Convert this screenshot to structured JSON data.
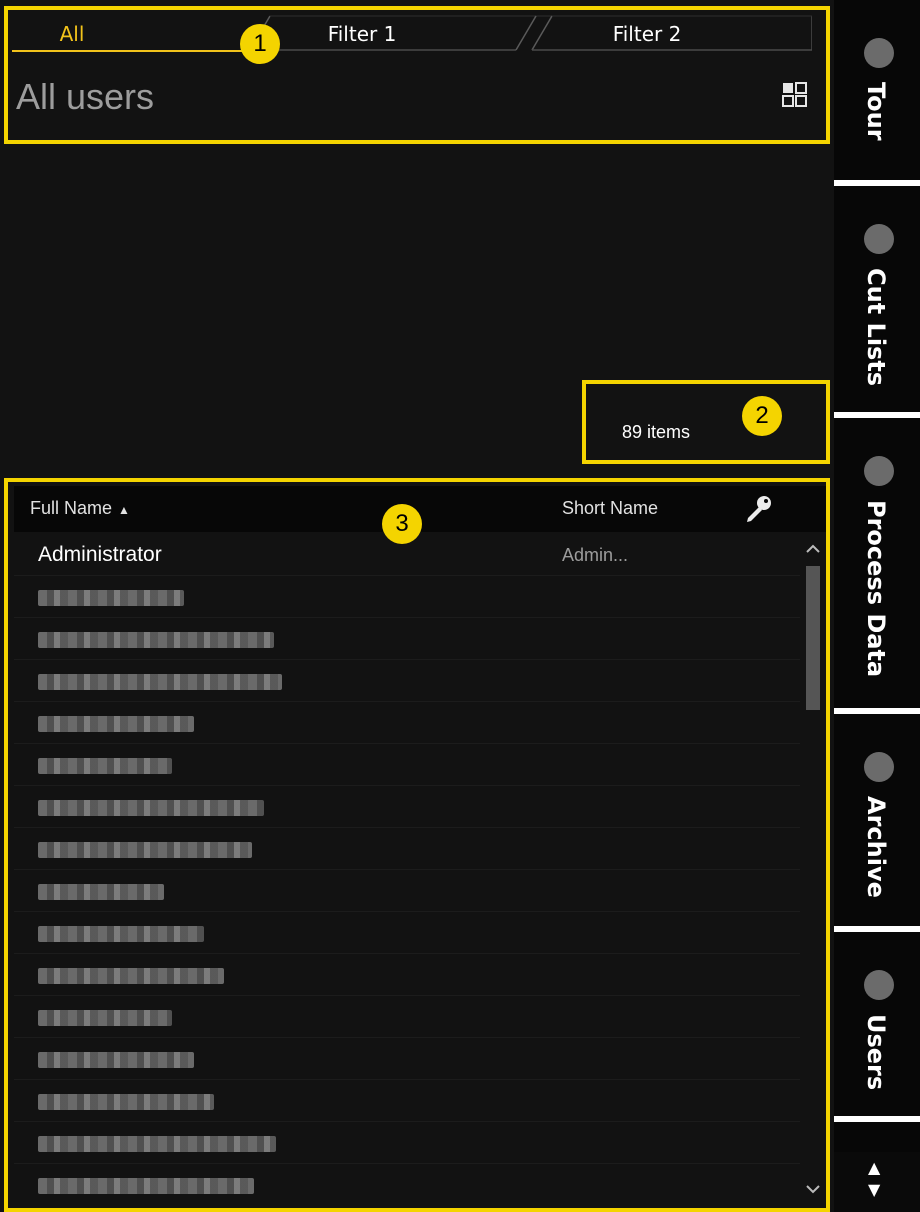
{
  "tabs": [
    {
      "label": "All",
      "active": true
    },
    {
      "label": "Filter 1",
      "active": false
    },
    {
      "label": "Filter 2",
      "active": false
    }
  ],
  "page_title": "All users",
  "view_toggle_icon": "grid-view-icon",
  "items_count": "89 items",
  "table": {
    "columns": {
      "full_name": "Full Name",
      "short_name": "Short Name",
      "key": "key-icon"
    },
    "sort_indicator": "▲",
    "rows": [
      {
        "full_name": "Administrator",
        "short_name": "Admin..."
      }
    ],
    "redacted_rows": 15
  },
  "sidebar": {
    "items": [
      {
        "label": "Tour"
      },
      {
        "label": "Cut Lists"
      },
      {
        "label": "Process Data"
      },
      {
        "label": "Archive"
      },
      {
        "label": "Users"
      }
    ],
    "scroll_up": "▲",
    "scroll_down": "▼"
  },
  "callouts": [
    "1",
    "2",
    "3"
  ],
  "colors": {
    "accent": "#f2c31b",
    "annotation": "#f4d400",
    "background": "#121212",
    "sidebar_tab": "#070707"
  }
}
